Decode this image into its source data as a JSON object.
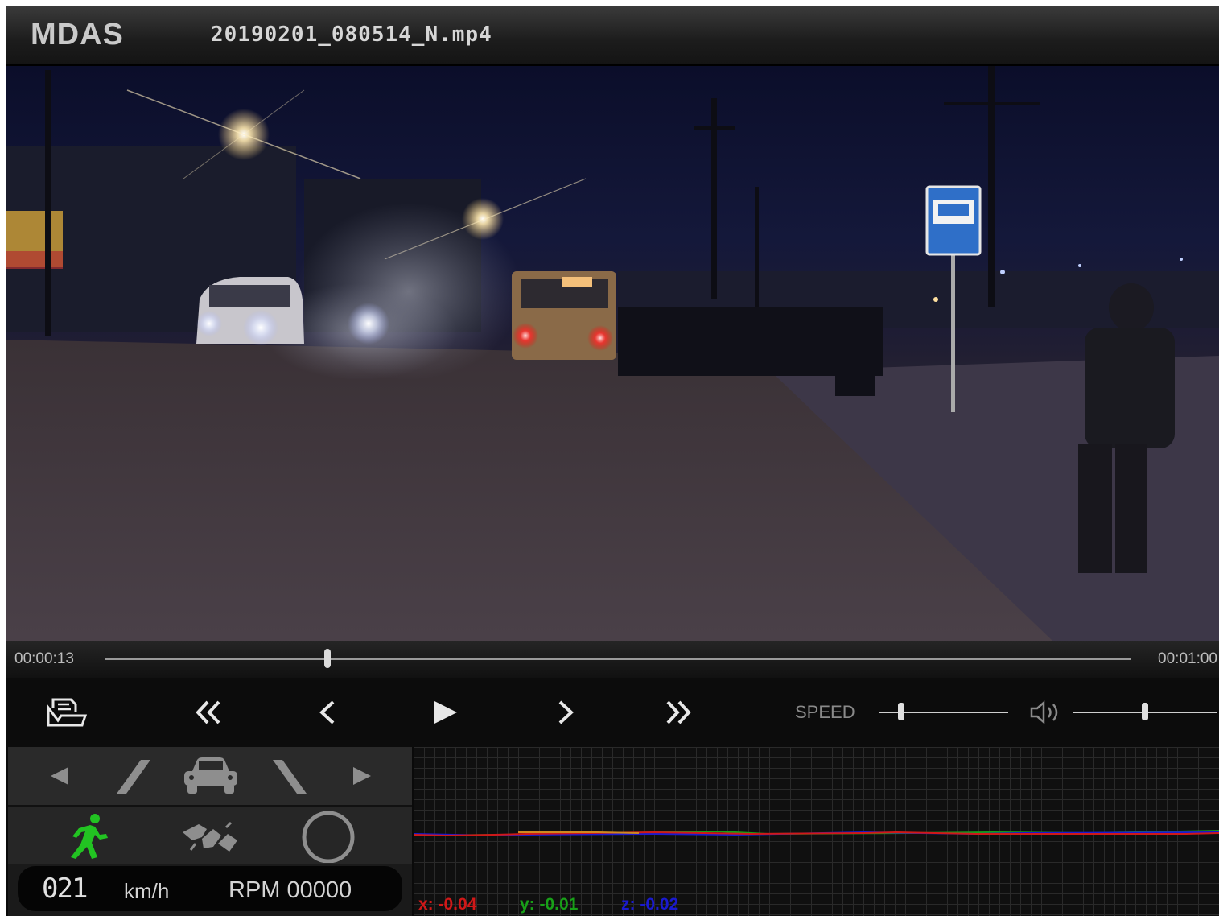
{
  "titlebar": {
    "app_name": "MDAS",
    "file_name": "20190201_080514_N.mp4"
  },
  "timeline": {
    "current": "00:00:13",
    "total": "00:01:00",
    "progress_fraction": 0.2167
  },
  "controls": {
    "icons": [
      "open-file-icon",
      "fast-rewind-icon",
      "step-back-icon",
      "play-icon",
      "step-forward-icon",
      "fast-forward-icon",
      "volume-icon"
    ],
    "speed_label": "SPEED",
    "speed_level": 0.17,
    "volume_level": 0.5
  },
  "adas": {
    "icons": [
      "left-arrow-icon",
      "left-lane-line-icon",
      "car-icon",
      "right-lane-line-icon",
      "right-arrow-icon"
    ],
    "status_icons": [
      "pedestrian-icon",
      "collision-icon",
      "circle-icon"
    ],
    "pedestrian_color": "#22c322"
  },
  "readout": {
    "speed": "021",
    "speed_unit": "km/h",
    "rpm": "RPM 00000"
  },
  "graph": {
    "x_value": "x: -0.04",
    "y_value": "y: -0.01",
    "z_value": "z: -0.02",
    "colors": {
      "x": "#d01818",
      "y": "#18a018",
      "z": "#1a1ad0"
    }
  }
}
